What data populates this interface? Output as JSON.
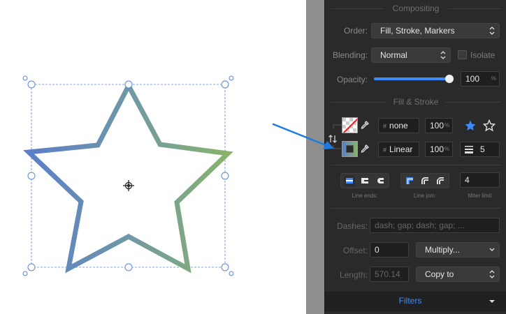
{
  "panel": {
    "compositing": {
      "title": "Compositing",
      "order_label": "Order:",
      "order_value": "Fill, Stroke, Markers",
      "blending_label": "Blending:",
      "blending_value": "Normal",
      "isolate_label": "Isolate",
      "isolate_checked": false,
      "opacity_label": "Opacity:",
      "opacity_value": "100",
      "opacity_unit": "%",
      "opacity_fraction": 1.0
    },
    "fill_stroke": {
      "title": "Fill & Stroke",
      "fill_value": "none",
      "fill_opacity": "100",
      "fill_opacity_unit": "%",
      "stroke_value": "Linear",
      "stroke_opacity": "100",
      "stroke_opacity_unit": "%",
      "stroke_width": "5",
      "hash_symbol": "#"
    },
    "line": {
      "line_ends_label": "Line ends:",
      "line_join_label": "Line join:",
      "miter_value": "4",
      "miter_label": "Miter limit"
    },
    "dashes": {
      "dashes_label": "Dashes:",
      "dashes_placeholder": "dash; gap; dash; gap; ...",
      "offset_label": "Offset:",
      "offset_value": "0",
      "multiply_label": "Multiply...",
      "length_label": "Length:",
      "length_value": "570.14",
      "copy_label": "Copy to"
    },
    "filters_label": "Filters"
  },
  "colors": {
    "accent": "#3d8cff",
    "panel_bg": "#2a2a2a",
    "gradient_start": "#5b7fc8",
    "gradient_end": "#88b36a",
    "selection": "#5a86d6"
  }
}
